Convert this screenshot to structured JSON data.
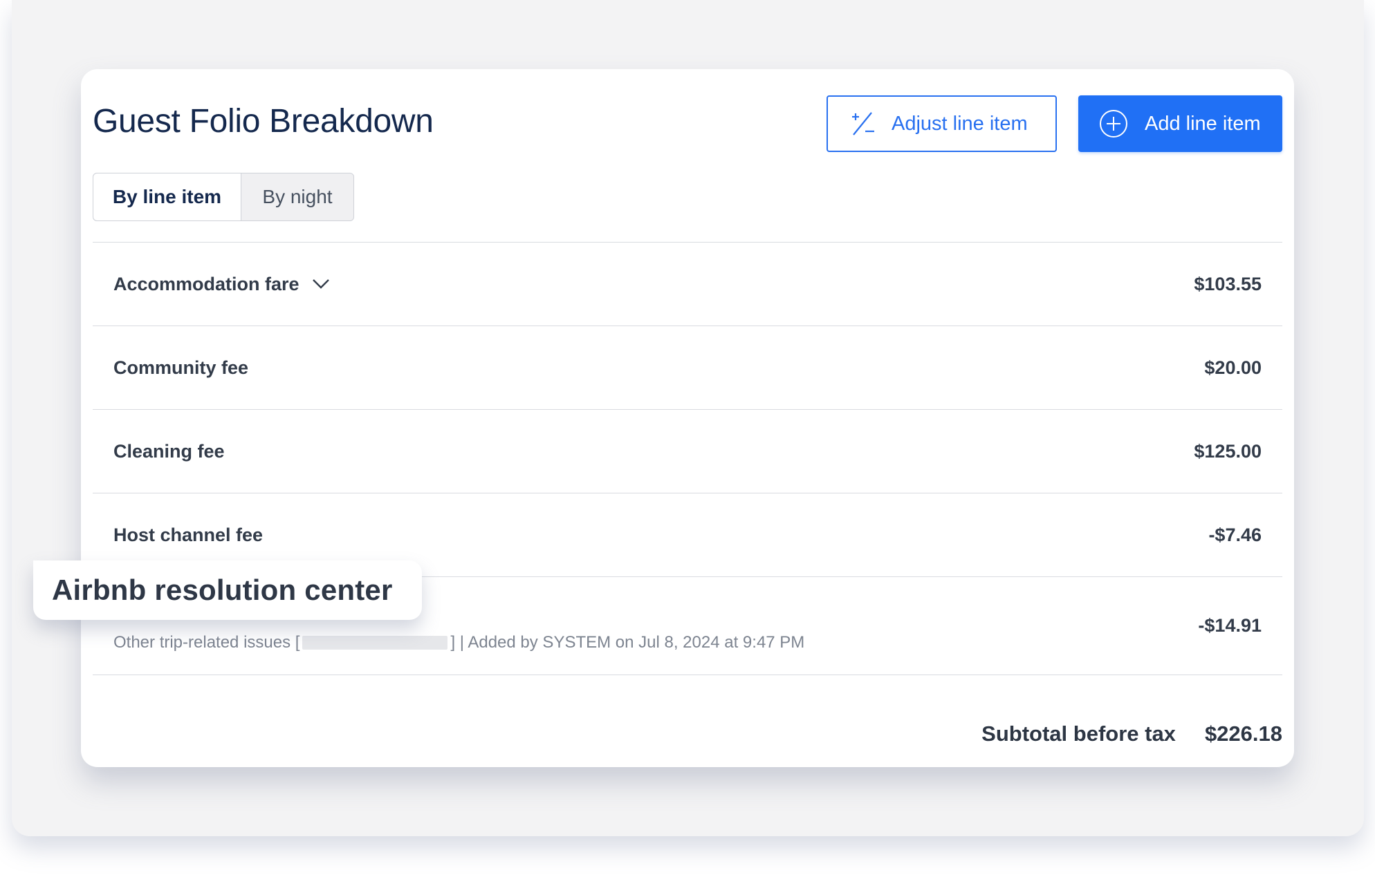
{
  "header": {
    "title": "Guest Folio Breakdown",
    "adjust_label": "Adjust line item",
    "add_label": "Add line item"
  },
  "view_toggle": {
    "options": [
      "By line item",
      "By night"
    ],
    "selected": "By line item"
  },
  "line_items": [
    {
      "label": "Accommodation fare",
      "amount": "$103.55",
      "expandable": true
    },
    {
      "label": "Community fee",
      "amount": "$20.00"
    },
    {
      "label": "Cleaning fee",
      "amount": "$125.00"
    },
    {
      "label": "Host channel fee",
      "amount": "-$7.46"
    },
    {
      "label": "Airbnb resolution center",
      "amount": "-$14.91",
      "note_prefix": "Other trip-related issues [",
      "note_suffix": "] | Added by SYSTEM on Jul 8, 2024 at 9:47 PM"
    }
  ],
  "subtotal": {
    "label": "Subtotal before tax",
    "amount": "$226.18"
  },
  "colors": {
    "primary": "#2070f5",
    "title": "#14284d",
    "text": "#323b49"
  },
  "icons": {
    "adjust": "plus-minus-icon",
    "add": "plus-circle-icon",
    "expand": "chevron-down-icon"
  }
}
